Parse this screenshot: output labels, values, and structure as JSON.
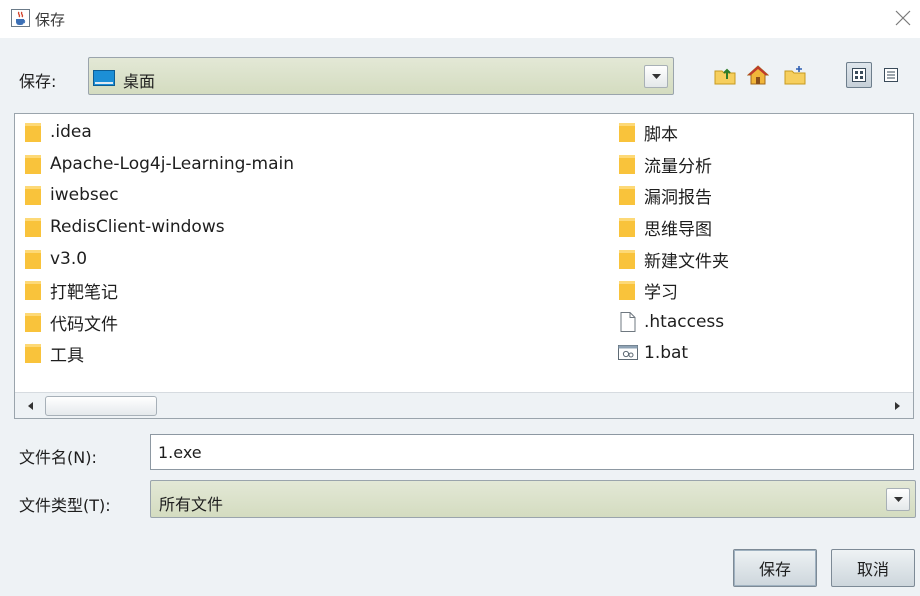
{
  "window": {
    "title": "保存",
    "app_icon": "java-cup-icon",
    "close_icon": "close-icon"
  },
  "save_in": {
    "label": "保存:",
    "value": "桌面",
    "icon": "desktop-folder-icon"
  },
  "toolbar": {
    "buttons": [
      {
        "name": "up-one-level",
        "icon": "folder-up-icon"
      },
      {
        "name": "home",
        "icon": "home-icon"
      },
      {
        "name": "new-folder",
        "icon": "new-folder-icon"
      },
      {
        "name": "list-view",
        "icon": "list-view-icon",
        "active": true
      },
      {
        "name": "details-view",
        "icon": "details-view-icon",
        "active": false
      }
    ]
  },
  "files": {
    "column1": [
      {
        "name": ".idea",
        "type": "folder"
      },
      {
        "name": "Apache-Log4j-Learning-main",
        "type": "folder"
      },
      {
        "name": "iwebsec",
        "type": "folder"
      },
      {
        "name": "RedisClient-windows",
        "type": "folder"
      },
      {
        "name": "v3.0",
        "type": "folder"
      },
      {
        "name": "打靶笔记",
        "type": "folder"
      },
      {
        "name": "代码文件",
        "type": "folder"
      },
      {
        "name": "工具",
        "type": "folder"
      }
    ],
    "column2": [
      {
        "name": "脚本",
        "type": "folder"
      },
      {
        "name": "流量分析",
        "type": "folder"
      },
      {
        "name": "漏洞报告",
        "type": "folder"
      },
      {
        "name": "思维导图",
        "type": "folder"
      },
      {
        "name": "新建文件夹",
        "type": "folder"
      },
      {
        "name": "学习",
        "type": "folder"
      },
      {
        "name": ".htaccess",
        "type": "file"
      },
      {
        "name": "1.bat",
        "type": "batch"
      }
    ]
  },
  "filename": {
    "label": "文件名(N):",
    "value": "1.exe"
  },
  "filetype": {
    "label": "文件类型(T):",
    "value": "所有文件"
  },
  "buttons": {
    "save_label": "保存",
    "cancel_label": "取消"
  },
  "colors": {
    "panel_bg": "#eef2f5",
    "combo_bg": "#d4dcc0",
    "folder_yellow": "#f9c33b",
    "border": "#9aa4ac"
  }
}
